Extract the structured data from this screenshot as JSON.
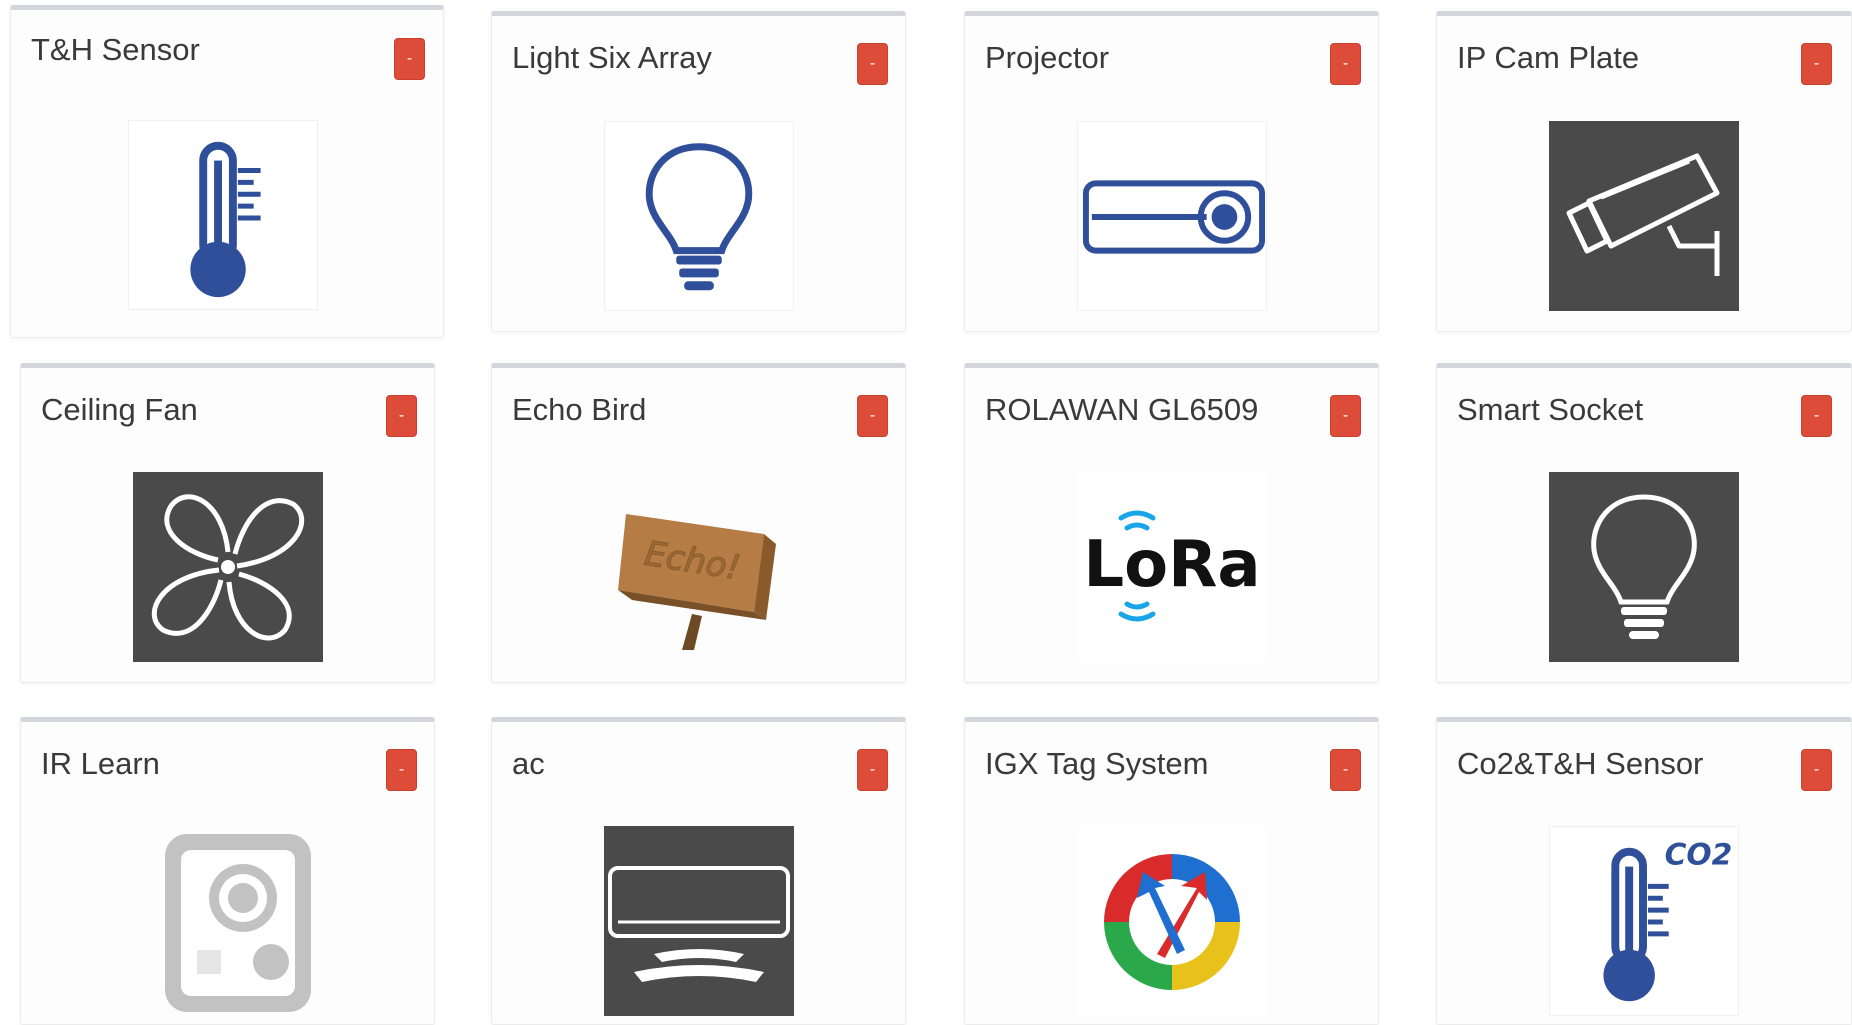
{
  "devices": [
    {
      "name": "T&H Sensor",
      "icon": "thermometer-icon",
      "delete_label": "-"
    },
    {
      "name": "Light Six Array",
      "icon": "light-bulb-icon",
      "delete_label": "-"
    },
    {
      "name": "Projector",
      "icon": "projector-icon",
      "delete_label": "-"
    },
    {
      "name": "IP Cam Plate",
      "icon": "security-camera-icon",
      "delete_label": "-"
    },
    {
      "name": "Ceiling Fan",
      "icon": "fan-icon",
      "delete_label": "-"
    },
    {
      "name": "Echo Bird",
      "icon": "echo-bird-sign-image",
      "image_text": "Echo!",
      "delete_label": "-"
    },
    {
      "name": "ROLAWAN GL6509",
      "icon": "lora-logo",
      "logo_text": "LoRa",
      "delete_label": "-"
    },
    {
      "name": "Smart Socket",
      "icon": "light-bulb-icon",
      "delete_label": "-"
    },
    {
      "name": "IR Learn",
      "icon": "speaker-icon",
      "delete_label": "-"
    },
    {
      "name": "ac",
      "icon": "air-conditioner-icon",
      "delete_label": "-"
    },
    {
      "name": "IGX Tag System",
      "icon": "igx-logo",
      "delete_label": "-"
    },
    {
      "name": "Co2&T&H Sensor",
      "icon": "co2-thermometer-icon",
      "image_text": "CO2",
      "delete_label": "-"
    }
  ],
  "colors": {
    "delete_button": "#dd4b39",
    "icon_blue": "#2f4f9a",
    "tile_dark": "#4a4a4a",
    "card_top_border": "#d4d6de"
  }
}
